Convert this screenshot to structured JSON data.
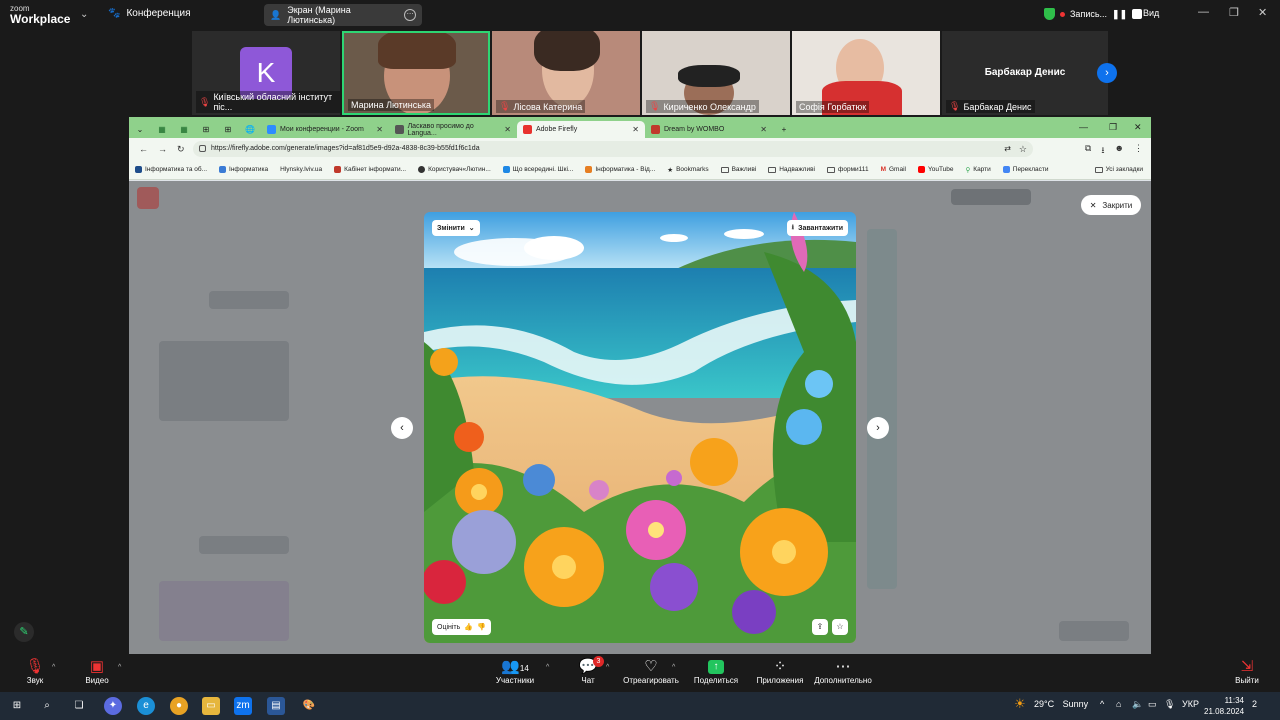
{
  "zoom": {
    "logo_line1": "zoom",
    "logo_line2": "Workplace",
    "meeting_label": "Конференция",
    "screen_share_label": "Экран (Марина Лютинська)",
    "record_label": "Запись...",
    "view_label": "Вид"
  },
  "participants": [
    {
      "name": "Київський обласний інститут піс...",
      "muted": true,
      "avatar_letter": "K"
    },
    {
      "name": "Марина Лютинська",
      "muted": false,
      "active": true
    },
    {
      "name": "Лісова Катерина",
      "muted": true
    },
    {
      "name": "Кириченко Олександр",
      "muted": true
    },
    {
      "name": "Софія Горбатюк",
      "muted": false
    },
    {
      "name": "Барбакар Денис",
      "muted": true,
      "display_name": "Барбакар Денис"
    }
  ],
  "browser": {
    "tabs": [
      {
        "label": "Мои конференции - Zoom",
        "color": "#2d8cff"
      },
      {
        "label": "Ласкаво просимо до Langua...",
        "color": "#555555"
      },
      {
        "label": "Adobe Firefly",
        "color": "#e8322e",
        "active": true
      },
      {
        "label": "Dream by WOMBO",
        "color": "#c0392b"
      }
    ],
    "url": "https://firefly.adobe.com/generate/images?id=af81d5e9-d92a-4838-8c39-b55fd1f6c1da",
    "bookmarks": [
      "Інформатика та об...",
      "Інформатика",
      "Hlynsky.lviv.ua",
      "Кабінет інформати...",
      "Користувач«Лютин...",
      "Що всередині. Шкі...",
      "Інформатика - Від...",
      "Bookmarks",
      "Важливі",
      "Надважливі",
      "форми111",
      "Gmail",
      "YouTube",
      "Карти",
      "Перекласти"
    ],
    "all_bookmarks": "Усі закладки"
  },
  "firefly": {
    "close_label": "Закрити",
    "edit_label": "Змінити",
    "download_label": "Завантажити",
    "rate_label": "Оцініть"
  },
  "toolbar": {
    "audio": "Звук",
    "video": "Видео",
    "participants": "Участники",
    "participants_count": "14",
    "chat": "Чат",
    "chat_badge": "3",
    "react": "Отреагировать",
    "share": "Поделиться",
    "apps": "Приложения",
    "more": "Дополнительно",
    "leave": "Выйти"
  },
  "taskbar": {
    "weather_temp": "29°C",
    "weather_desc": "Sunny",
    "lang": "УКР",
    "time": "11:34",
    "date": "21.08.2024",
    "notif_count": "2"
  },
  "colors": {
    "zoom_bg": "#1a1a1a",
    "active_speaker": "#2ed573",
    "browser_tabbar": "#8fd18b",
    "zoom_blue": "#0e72ed"
  }
}
